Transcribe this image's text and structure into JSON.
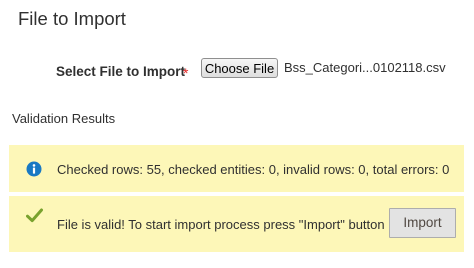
{
  "section": {
    "title": "File to Import"
  },
  "file_select": {
    "label": "Select File to Import",
    "required_mark": "*",
    "button_label": "Choose File",
    "file_name": "Bss_Categori...0102118.csv"
  },
  "validation": {
    "heading": "Validation Results",
    "info_message": "Checked rows: 55, checked entities: 0, invalid rows: 0, total errors: 0",
    "success_message": "File is valid! To start import process press \"Import\" button",
    "import_button_label": "Import"
  },
  "icons": {
    "info": "info-circle-icon",
    "success": "checkmark-icon"
  },
  "colors": {
    "message_background": "#fdf7b8",
    "info_icon": "#1979c3",
    "success_icon": "#79a22e",
    "required_star": "#e22626"
  }
}
